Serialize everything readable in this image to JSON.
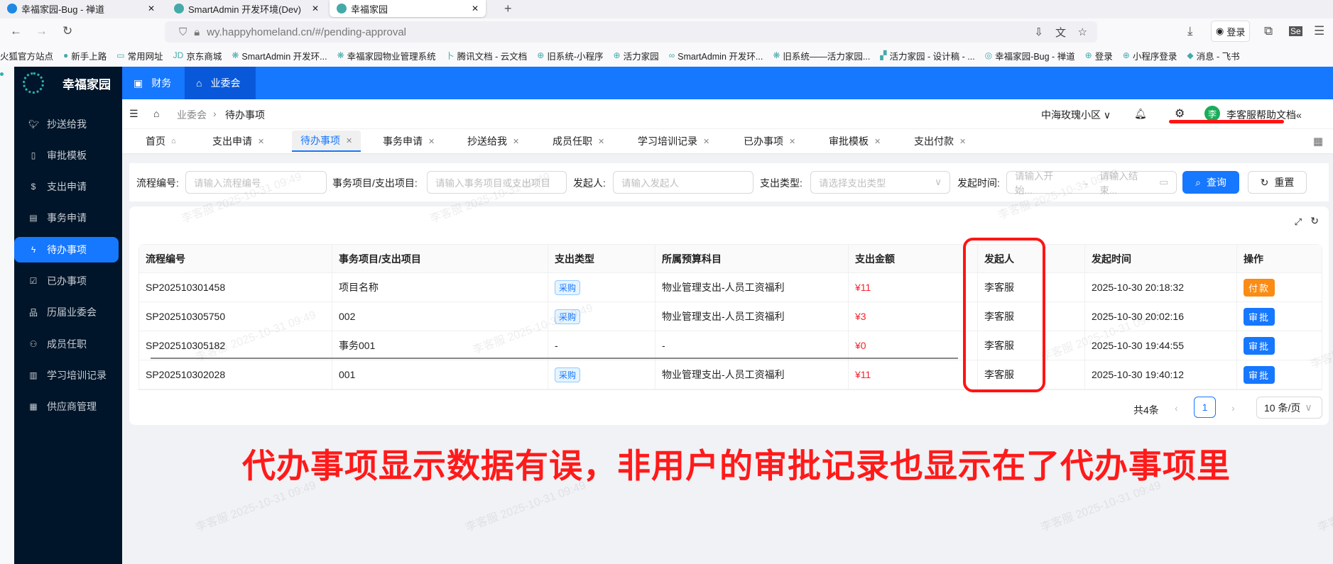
{
  "browser": {
    "tabs": [
      {
        "label": "幸福家园-Bug - 禅道",
        "active": false
      },
      {
        "label": "SmartAdmin 开发环境(Dev)",
        "active": false
      },
      {
        "label": "幸福家园",
        "active": true
      }
    ],
    "new_tab": "+",
    "url": "wy.happyhomeland.cn/#/pending-approval",
    "login_label": "登录",
    "bookmarks": [
      "火狐官方站点",
      "新手上路",
      "常用网址",
      "京东商城",
      "SmartAdmin 开发环...",
      "幸福家园物业管理系统",
      "腾讯文档 - 云文档",
      "旧系统-小程序",
      "活力家园",
      "SmartAdmin 开发环...",
      "旧系统——活力家园...",
      "活力家园 - 设计稿 - ...",
      "幸福家园-Bug - 禅道",
      "登录",
      "小程序登录",
      "消息 - 飞书"
    ]
  },
  "app": {
    "logo_text": "幸福家园",
    "top_menu": [
      {
        "label": "财务",
        "icon": "finance-icon"
      },
      {
        "label": "业委会",
        "icon": "bank-icon"
      }
    ],
    "sidebar": [
      {
        "label": "抄送给我",
        "icon": "bird-icon"
      },
      {
        "label": "审批模板",
        "icon": "file-icon"
      },
      {
        "label": "支出申请",
        "icon": "dollar-icon"
      },
      {
        "label": "事务申请",
        "icon": "doc-icon"
      },
      {
        "label": "待办事项",
        "icon": "thunder-icon",
        "active": true
      },
      {
        "label": "已办事项",
        "icon": "calendar-check-icon"
      },
      {
        "label": "历届业委会",
        "icon": "cluster-icon"
      },
      {
        "label": "成员任职",
        "icon": "team-icon"
      },
      {
        "label": "学习培训记录",
        "icon": "book-icon"
      },
      {
        "label": "供应商管理",
        "icon": "shop-icon"
      }
    ],
    "breadcrumb": [
      "业委会",
      "待办事项"
    ],
    "community": "中海玫瑰小区",
    "avatar_char": "李",
    "user_name": "李客服",
    "help": "帮助文档",
    "page_tabs": [
      "首页",
      "支出申请",
      "待办事项",
      "事务申请",
      "抄送给我",
      "成员任职",
      "学习培训记录",
      "已办事项",
      "审批模板",
      "支出付款"
    ],
    "active_tab": "待办事项"
  },
  "search": {
    "fields": [
      {
        "label": "流程编号:",
        "placeholder": "请输入流程编号"
      },
      {
        "label": "事务项目/支出项目:",
        "placeholder": "请输入事务项目或支出项目"
      },
      {
        "label": "发起人:",
        "placeholder": "请输入发起人"
      },
      {
        "label": "支出类型:",
        "placeholder": "请选择支出类型"
      },
      {
        "label": "发起时间:",
        "placeholder": "请输入开始...",
        "placeholder_end": "请输入结束..."
      }
    ],
    "query": "查询",
    "reset": "重置"
  },
  "table": {
    "columns": [
      "流程编号",
      "事务项目/支出项目",
      "支出类型",
      "所属预算科目",
      "支出金额",
      "发起人",
      "发起时间",
      "操作"
    ],
    "rows": [
      {
        "id": "SP202510301458",
        "item": "项目名称",
        "type": "采购",
        "budget": "物业管理支出-人员工资福利",
        "amount": "¥11",
        "initiator": "李客服",
        "time": "2025-10-30 20:18:32",
        "action": "付款",
        "action_color": "#fa8c16"
      },
      {
        "id": "SP202510305750",
        "item": "002",
        "type": "采购",
        "budget": "物业管理支出-人员工资福利",
        "amount": "¥3",
        "initiator": "李客服",
        "time": "2025-10-30 20:02:16",
        "action": "审批",
        "action_color": "#1677ff"
      },
      {
        "id": "SP202510305182",
        "item": "事务001",
        "type": "-",
        "budget": "-",
        "amount": "¥0",
        "initiator": "李客服",
        "time": "2025-10-30 19:44:55",
        "action": "审批",
        "action_color": "#1677ff"
      },
      {
        "id": "SP202510302028",
        "item": "001",
        "type": "采购",
        "budget": "物业管理支出-人员工资福利",
        "amount": "¥11",
        "initiator": "李客服",
        "time": "2025-10-30 19:40:12",
        "action": "审批",
        "action_color": "#1677ff"
      }
    ]
  },
  "pagination": {
    "total": "共4条",
    "current": "1",
    "page_size": "10 条/页"
  },
  "watermark": "李客服 2025-10-31 09:49",
  "annotation": "代办事项显示数据有误，非用户的审批记录也显示在了代办事项里",
  "colors": {
    "primary": "#1677ff",
    "sidebar": "#001529",
    "annotation": "#ff1414",
    "amount": "#f5222d"
  }
}
